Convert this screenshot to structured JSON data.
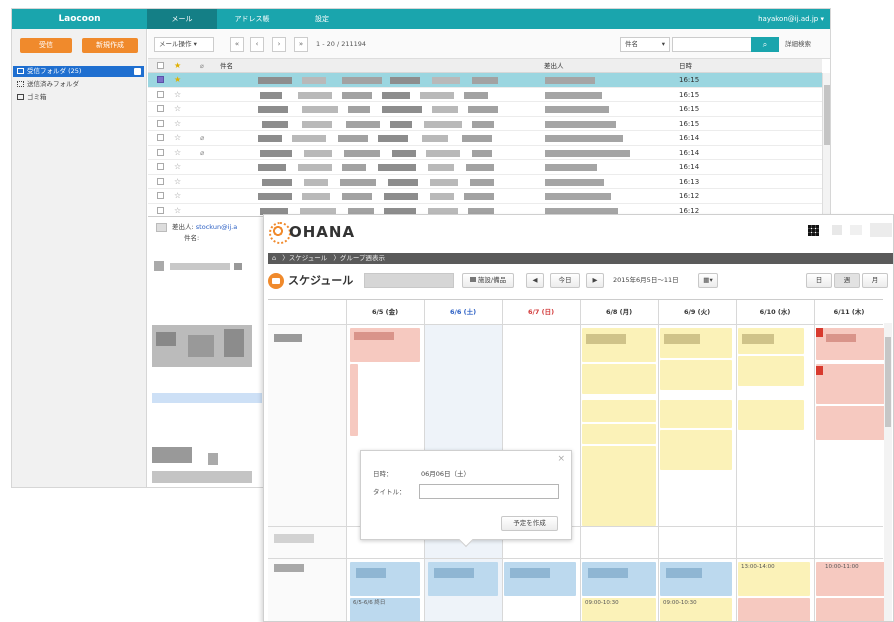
{
  "mail": {
    "app_title": "Laocoon",
    "tabs": [
      {
        "label": "メール"
      },
      {
        "label": "アドレス帳"
      },
      {
        "label": "設定"
      }
    ],
    "user": "hayakon@ij.ad.jp",
    "user_caret": "▾",
    "sidebar": {
      "receive_button": "受信",
      "compose_button": "新規作成",
      "folders": [
        {
          "label": "受信フォルダ (25)"
        },
        {
          "label": "送信済みフォルダ"
        },
        {
          "label": "ゴミ箱"
        }
      ]
    },
    "toolbar": {
      "action_select": "メール操作 ▾",
      "first": "«",
      "prev": "‹",
      "next": "›",
      "last": "»",
      "count": "1 - 20 / 211194",
      "search_field": "件名",
      "search_caret": "▾",
      "search_icon_glyph": "⌕",
      "advanced_search": "詳細検索"
    },
    "list_header": {
      "subject": "件名",
      "sender": "差出人",
      "date": "日時"
    },
    "rows": [
      {
        "time": "16:15",
        "star": "★",
        "starred": true,
        "attach": ""
      },
      {
        "time": "16:15",
        "star": "☆",
        "attach": ""
      },
      {
        "time": "16:15",
        "star": "☆",
        "attach": ""
      },
      {
        "time": "16:15",
        "star": "☆",
        "attach": ""
      },
      {
        "time": "16:14",
        "star": "☆",
        "attach": "⌀"
      },
      {
        "time": "16:14",
        "star": "☆",
        "attach": "⌀"
      },
      {
        "time": "16:14",
        "star": "☆",
        "attach": ""
      },
      {
        "time": "16:13",
        "star": "☆",
        "attach": ""
      },
      {
        "time": "16:12",
        "star": "☆",
        "attach": ""
      },
      {
        "time": "16:12",
        "star": "☆",
        "attach": ""
      }
    ],
    "preview": {
      "from_label": "差出人:",
      "from_value": "stockun@ij.a",
      "subject_label": "件名:"
    }
  },
  "ohana": {
    "logo": "OHANA",
    "breadcrumb": [
      "⌂",
      "〉スケジュール",
      "〉グループ週表示"
    ],
    "title": "スケジュール",
    "buttons": {
      "today": "今日",
      "prev": "◀",
      "next": "▶",
      "facility": "施設/備品",
      "range": "2015年6月5日〜11日",
      "calendar": "▦▾",
      "view_day": "日",
      "view_week": "週",
      "view_month": "月"
    },
    "days": [
      {
        "label": "6/5 (金)",
        "type": "weekday"
      },
      {
        "label": "6/6 (土)",
        "type": "sat"
      },
      {
        "label": "6/7 (日)",
        "type": "sun"
      },
      {
        "label": "6/8 (月)",
        "type": "weekday"
      },
      {
        "label": "6/9 (火)",
        "type": "weekday"
      },
      {
        "label": "6/10 (水)",
        "type": "weekday"
      },
      {
        "label": "6/11 (木)",
        "type": "weekday"
      }
    ],
    "popup": {
      "date_label": "日時：",
      "date_value": "06月06日（土）",
      "title_label": "タイトル：",
      "title_value": "",
      "create_button": "予定を作成",
      "close": "×"
    },
    "event_times": {
      "e1": "6/5-6/6 終日",
      "e2": "09:00-10:30",
      "e3": "09:00-10:30",
      "e4": "13:00-14:00",
      "e5": "10:00-11:00"
    },
    "colors": {
      "accent": "#1aa5ad",
      "orange": "#f08a2c",
      "event_yellow": "#fbf2b8",
      "event_red": "#f6c9c0",
      "event_blue": "#bcd9ee"
    }
  }
}
